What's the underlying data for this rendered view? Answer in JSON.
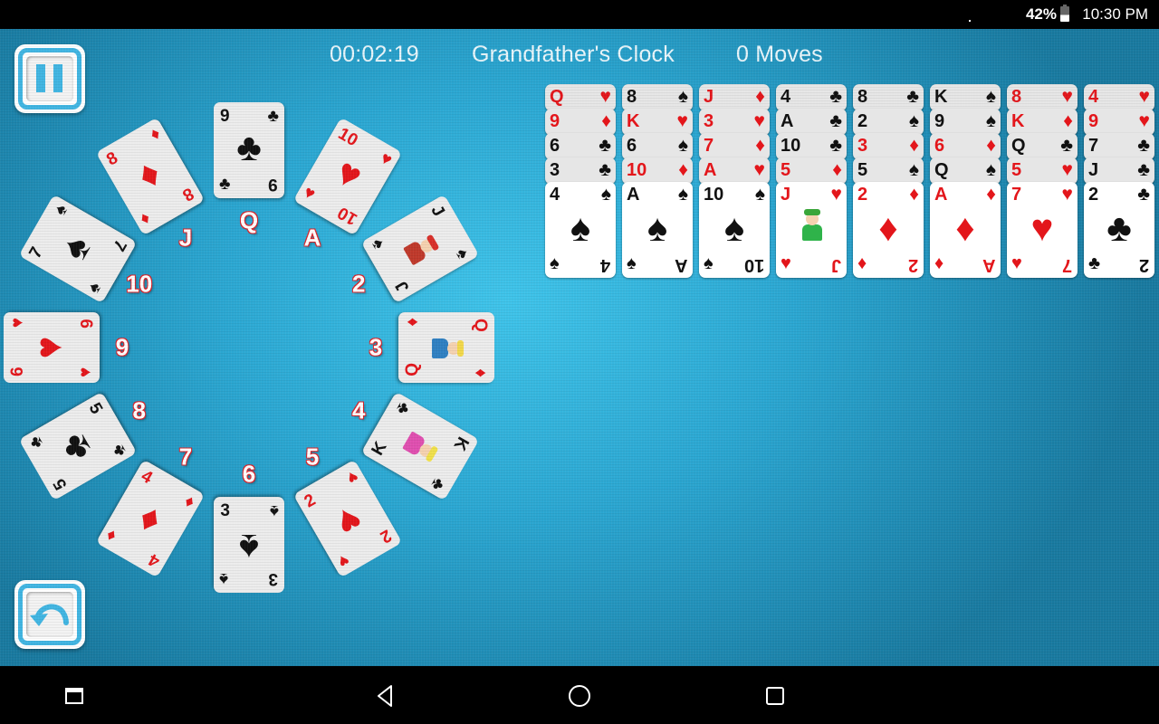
{
  "status_bar": {
    "battery_percent": "42%",
    "time": "10:30 PM"
  },
  "hud": {
    "timer": "00:02:19",
    "game_title": "Grandfather's Clock",
    "moves": "0 Moves"
  },
  "buttons": {
    "pause": "pause-icon",
    "undo": "undo-icon"
  },
  "colors": {
    "table_center": "#3fc4ea",
    "table_edge": "#197aa0",
    "button_accent": "#41b5e2",
    "red_suit": "#e3161b",
    "label_outline": "#d9232a"
  },
  "clock": {
    "labels": [
      "A",
      "2",
      "3",
      "4",
      "5",
      "6",
      "7",
      "8",
      "9",
      "10",
      "J",
      "Q"
    ],
    "cards": [
      {
        "position": "Q",
        "rank": "9",
        "suit": "♣",
        "color": "black"
      },
      {
        "position": "A",
        "rank": "10",
        "suit": "♥",
        "color": "red"
      },
      {
        "position": "2",
        "rank": "J",
        "suit": "♠",
        "color": "black",
        "face": true
      },
      {
        "position": "3",
        "rank": "Q",
        "suit": "♦",
        "color": "red",
        "face": true
      },
      {
        "position": "4",
        "rank": "K",
        "suit": "♣",
        "color": "black",
        "face": true
      },
      {
        "position": "5",
        "rank": "2",
        "suit": "♥",
        "color": "red"
      },
      {
        "position": "6",
        "rank": "3",
        "suit": "♠",
        "color": "black"
      },
      {
        "position": "7",
        "rank": "4",
        "suit": "♦",
        "color": "red"
      },
      {
        "position": "8",
        "rank": "5",
        "suit": "♣",
        "color": "black"
      },
      {
        "position": "9",
        "rank": "6",
        "suit": "♥",
        "color": "red"
      },
      {
        "position": "10",
        "rank": "7",
        "suit": "♠",
        "color": "black"
      },
      {
        "position": "J",
        "rank": "8",
        "suit": "♦",
        "color": "red"
      }
    ]
  },
  "tableau": [
    [
      {
        "rank": "Q",
        "suit": "♥",
        "color": "red"
      },
      {
        "rank": "9",
        "suit": "♦",
        "color": "red"
      },
      {
        "rank": "6",
        "suit": "♣",
        "color": "black"
      },
      {
        "rank": "3",
        "suit": "♣",
        "color": "black"
      },
      {
        "rank": "4",
        "suit": "♠",
        "color": "black"
      }
    ],
    [
      {
        "rank": "8",
        "suit": "♠",
        "color": "black"
      },
      {
        "rank": "K",
        "suit": "♥",
        "color": "red"
      },
      {
        "rank": "6",
        "suit": "♠",
        "color": "black"
      },
      {
        "rank": "10",
        "suit": "♦",
        "color": "red"
      },
      {
        "rank": "A",
        "suit": "♠",
        "color": "black"
      }
    ],
    [
      {
        "rank": "J",
        "suit": "♦",
        "color": "red"
      },
      {
        "rank": "3",
        "suit": "♥",
        "color": "red"
      },
      {
        "rank": "7",
        "suit": "♦",
        "color": "red"
      },
      {
        "rank": "A",
        "suit": "♥",
        "color": "red"
      },
      {
        "rank": "10",
        "suit": "♠",
        "color": "black"
      }
    ],
    [
      {
        "rank": "4",
        "suit": "♣",
        "color": "black"
      },
      {
        "rank": "A",
        "suit": "♣",
        "color": "black"
      },
      {
        "rank": "10",
        "suit": "♣",
        "color": "black"
      },
      {
        "rank": "5",
        "suit": "♦",
        "color": "red"
      },
      {
        "rank": "J",
        "suit": "♥",
        "color": "red",
        "face": true
      }
    ],
    [
      {
        "rank": "8",
        "suit": "♣",
        "color": "black"
      },
      {
        "rank": "2",
        "suit": "♠",
        "color": "black"
      },
      {
        "rank": "3",
        "suit": "♦",
        "color": "red"
      },
      {
        "rank": "5",
        "suit": "♠",
        "color": "black"
      },
      {
        "rank": "2",
        "suit": "♦",
        "color": "red"
      }
    ],
    [
      {
        "rank": "K",
        "suit": "♠",
        "color": "black"
      },
      {
        "rank": "9",
        "suit": "♠",
        "color": "black"
      },
      {
        "rank": "6",
        "suit": "♦",
        "color": "red"
      },
      {
        "rank": "Q",
        "suit": "♠",
        "color": "black"
      },
      {
        "rank": "A",
        "suit": "♦",
        "color": "red"
      }
    ],
    [
      {
        "rank": "8",
        "suit": "♥",
        "color": "red"
      },
      {
        "rank": "K",
        "suit": "♦",
        "color": "red"
      },
      {
        "rank": "Q",
        "suit": "♣",
        "color": "black"
      },
      {
        "rank": "5",
        "suit": "♥",
        "color": "red"
      },
      {
        "rank": "7",
        "suit": "♥",
        "color": "red"
      }
    ],
    [
      {
        "rank": "4",
        "suit": "♥",
        "color": "red"
      },
      {
        "rank": "9",
        "suit": "♥",
        "color": "red"
      },
      {
        "rank": "7",
        "suit": "♣",
        "color": "black"
      },
      {
        "rank": "J",
        "suit": "♣",
        "color": "black"
      },
      {
        "rank": "2",
        "suit": "♣",
        "color": "black"
      }
    ]
  ],
  "nav_bar": {
    "buttons": [
      "recents-alt-icon",
      "back-icon",
      "home-icon",
      "recents-icon"
    ]
  }
}
